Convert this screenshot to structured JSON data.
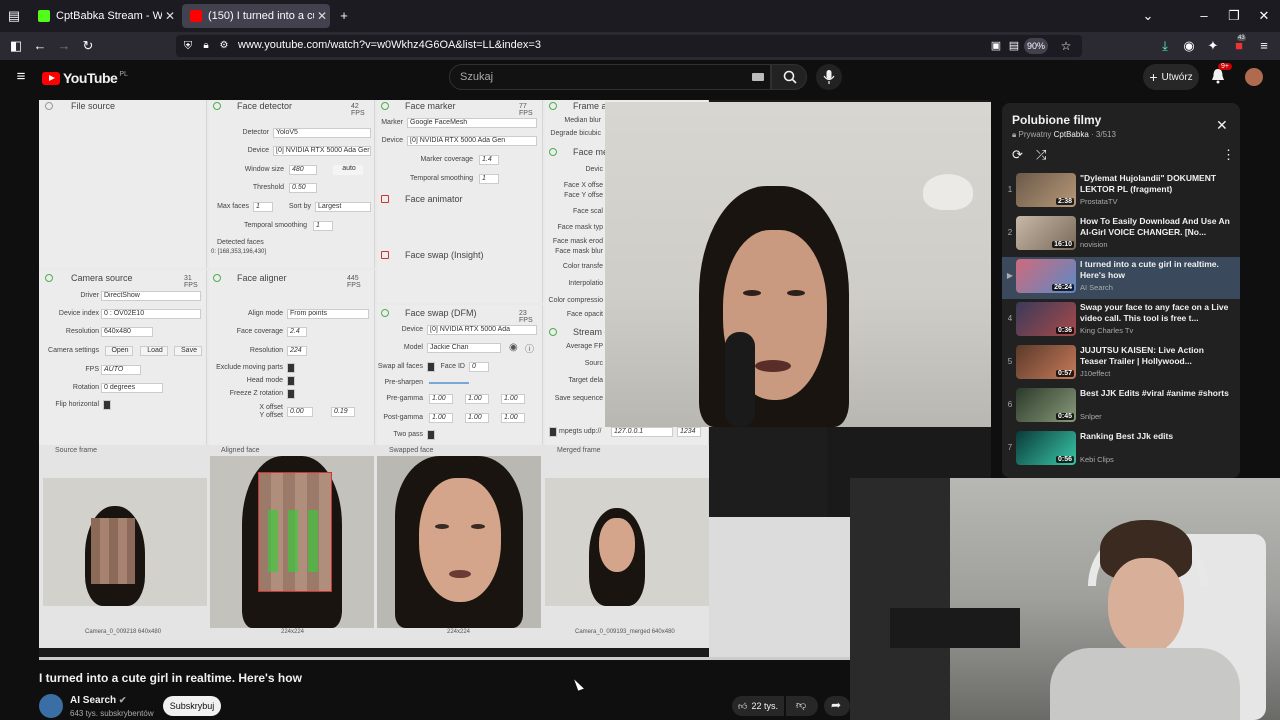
{
  "browser": {
    "tabs": [
      {
        "title": "CptBabka Stream - Watch Live o",
        "active": false
      },
      {
        "title": "(150) I turned into a cute gi",
        "active": true
      }
    ],
    "url": "www.youtube.com/watch?v=w0Wkhz4G6OA&list=LL&index=3",
    "zoom": "90%",
    "badge_count": "43"
  },
  "youtube": {
    "logo_text": "YouTube",
    "region": "PL",
    "search_placeholder": "Szukaj",
    "create_label": "Utwórz",
    "notif_count": "9+"
  },
  "app": {
    "panels": {
      "file_source": {
        "title": "File source"
      },
      "face_detector": {
        "title": "Face detector",
        "fps": "42 FPS",
        "detector": "YoloV5",
        "device": "[0] NVIDIA RTX 5000 Ada Ger",
        "window_size": "480",
        "window_auto": "auto",
        "threshold": "0.50",
        "max_faces": "1",
        "sort_by": "Largest",
        "temporal_smoothing": "1",
        "detected_faces": "Detected faces",
        "detected_coords": "0: [168,353,196,430]"
      },
      "face_marker": {
        "title": "Face marker",
        "fps": "77 FPS",
        "marker": "Google FaceMesh",
        "device": "[0] NVIDIA RTX 5000 Ada Gen",
        "marker_coverage": "1.4",
        "temporal_smoothing": "1"
      },
      "face_animator": {
        "title": "Face animator"
      },
      "face_swap_insight": {
        "title": "Face swap (Insight)"
      },
      "frame_adjuster": {
        "title": "Frame a",
        "median_blur": "Median blur",
        "degrade_bicubic": "Degrade bicubic"
      },
      "face_merger": {
        "title": "Face me",
        "labels": [
          "Devic",
          "Face X offse",
          "Face Y offse",
          "Face scal",
          "Face mask typ",
          "Face mask erod",
          "Face mask blur",
          "Color transfe",
          "Interpolatio",
          "Color compressio",
          "Face opacit"
        ]
      },
      "stream_output": {
        "title": "Stream o",
        "labels": [
          "Average FP",
          "Sourc",
          "Target dela",
          "Save sequence"
        ],
        "mpegts_label": "mpegts udp://",
        "mpegts_addr": "127.0.0.1",
        "mpegts_port": "1234"
      },
      "camera_source": {
        "title": "Camera source",
        "fps": "31 FPS",
        "driver": "DirectShow",
        "device_index": "0 : OV02E10",
        "resolution": "640x480",
        "settings_open": "Open",
        "settings_load": "Load",
        "settings_save": "Save",
        "cam_fps": "AUTO",
        "rotation": "0 degrees"
      },
      "face_aligner": {
        "title": "Face aligner",
        "fps": "445 FPS",
        "align_mode": "From points",
        "face_coverage": "2.4",
        "resolution": "224",
        "x_offset": "0.00",
        "y_offset": "0.19"
      },
      "face_swap_dfm": {
        "title": "Face swap (DFM)",
        "fps": "23 FPS",
        "device": "[0] NVIDIA RTX 5000 Ada",
        "model": "Jackie Chan",
        "face_id": "0",
        "pre_gamma": [
          "1.00",
          "1.00",
          "1.00"
        ],
        "post_gamma": [
          "1.00",
          "1.00",
          "1.00"
        ]
      }
    },
    "labels": {
      "detector": "Detector",
      "device": "Device",
      "window_size": "Window size",
      "threshold": "Threshold",
      "max_faces": "Max faces",
      "sort_by": "Sort by",
      "temporal_smoothing": "Temporal smoothing",
      "marker": "Marker",
      "marker_coverage": "Marker coverage",
      "driver": "Driver",
      "device_index": "Device index",
      "resolution": "Resolution",
      "camera_settings": "Camera settings",
      "fps": "FPS",
      "rotation": "Rotation",
      "flip_horizontal": "Flip horizontal",
      "align_mode": "Align mode",
      "face_coverage": "Face coverage",
      "exclude_moving": "Exclude moving parts",
      "head_mode": "Head mode",
      "freeze_z": "Freeze Z rotation",
      "x_offset": "X offset",
      "y_offset": "Y offset",
      "model": "Model",
      "swap_all": "Swap all faces",
      "face_id": "Face ID",
      "pre_sharpen": "Pre-sharpen",
      "pre_gamma": "Pre-gamma",
      "post_gamma": "Post-gamma",
      "two_pass": "Two pass"
    },
    "frames": [
      {
        "label": "Source frame",
        "caption": "Camera_0_009218 640x480"
      },
      {
        "label": "Aligned face",
        "caption": "224x224"
      },
      {
        "label": "Swapped face",
        "caption": "224x224"
      },
      {
        "label": "Merged frame",
        "caption": "Camera_0_009193_merged 640x480"
      }
    ]
  },
  "video": {
    "title": "I turned into a cute girl in realtime. Here's how",
    "channel": "AI Search",
    "subscribers": "643 tys. subskrybentów",
    "subscribe_label": "Subskrybuj",
    "likes": "22 tys.",
    "progress": 1.0
  },
  "playlist": {
    "title": "Polubione filmy",
    "privacy": "Prywatny",
    "owner": "CptBabka",
    "position": "3/513",
    "items": [
      {
        "num": "1",
        "title": "\"Dylemat Hujolandii\" DOKUMENT LEKTOR PL (fragment)",
        "channel": "ProstataTV",
        "duration": "2:38"
      },
      {
        "num": "2",
        "title": "How To Easily Download And Use An AI-Girl VOICE CHANGER. [No...",
        "channel": "novision",
        "duration": "16:10"
      },
      {
        "num": "▶",
        "title": "I turned into a cute girl in realtime. Here's how",
        "channel": "AI Search",
        "duration": "26:24"
      },
      {
        "num": "4",
        "title": "Swap your face to any face on a Live video call. This tool is free t...",
        "channel": "King Charles Tv",
        "duration": "0:36"
      },
      {
        "num": "5",
        "title": "JUJUTSU KAISEN: Live Action Teaser Trailer | Hollywood...",
        "channel": "J10effect",
        "duration": "0:57"
      },
      {
        "num": "6",
        "title": "Best JJK Edits #viral #anime #shorts",
        "channel": "Snlper",
        "duration": "0:45"
      },
      {
        "num": "7",
        "title": "Ranking Best JJk edits",
        "channel": "Kebi Clips",
        "duration": "0:56"
      }
    ]
  }
}
